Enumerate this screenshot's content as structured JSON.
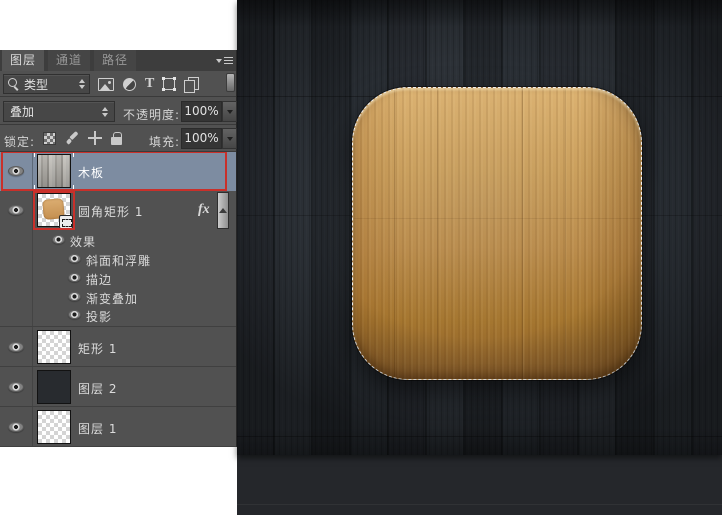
{
  "app": "Photoshop layers panel over canvas",
  "panel": {
    "tabs": [
      {
        "label": "图层",
        "active": true
      },
      {
        "label": "通道",
        "active": false
      },
      {
        "label": "路径",
        "active": false
      }
    ],
    "filter": {
      "kind": "类型"
    },
    "blend": {
      "mode": "叠加",
      "opacity_label": "不透明度:",
      "opacity_value": "100%"
    },
    "lock": {
      "lock_label": "锁定:",
      "fill_label": "填充:",
      "fill_value": "100%"
    },
    "fx_badge": "fx",
    "layers": [
      {
        "name": "木板",
        "visible": true,
        "selected": true,
        "thumb": "gray-wood-texture",
        "highlight": "red-box-row"
      },
      {
        "name": "圆角矩形 1",
        "visible": true,
        "thumb": "rounded-rect-shape-on-transparency",
        "shape_badge": true,
        "has_fx": true,
        "highlight": "red-box-thumbnail"
      },
      {
        "name": "效果",
        "visible": true,
        "type": "effects-header"
      },
      {
        "name": "斜面和浮雕",
        "visible": true,
        "type": "effect"
      },
      {
        "name": "描边",
        "visible": true,
        "type": "effect"
      },
      {
        "name": "渐变叠加",
        "visible": true,
        "type": "effect"
      },
      {
        "name": "投影",
        "visible": true,
        "type": "effect"
      },
      {
        "name": "矩形 1",
        "visible": true,
        "thumb": "transparent"
      },
      {
        "name": "图层 2",
        "visible": true,
        "thumb": "solid-dark"
      },
      {
        "name": "图层 1",
        "visible": true,
        "thumb": "transparent"
      }
    ]
  },
  "canvas": {
    "background": "dark wood planks",
    "icon": "light wood rounded-square app icon",
    "selection_marching_ants": true
  },
  "colors": {
    "panel_bg": "#515151",
    "tabbar_bg": "#3d3d3d",
    "selected_row_blue": "#7d8ca1",
    "highlight_red": "#c9302a",
    "field_bg": "#474747",
    "value_bg": "#353535",
    "pasteboard": "#25272b",
    "canvas_wood_dark": "#23262b",
    "icon_wood_top": "#dcb271",
    "icon_wood_bottom": "#8b5f2c"
  }
}
